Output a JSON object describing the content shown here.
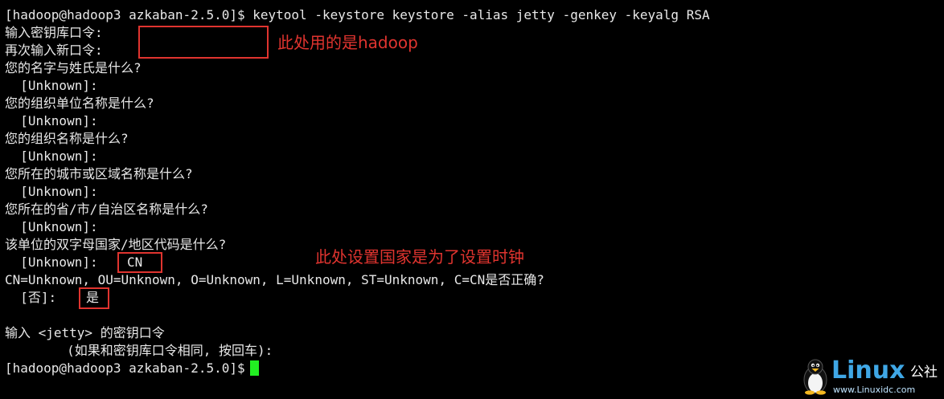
{
  "terminal": {
    "lines": [
      "[hadoop@hadoop3 azkaban-2.5.0]$ keytool -keystore keystore -alias jetty -genkey -keyalg RSA",
      "输入密钥库口令:",
      "再次输入新口令:",
      "您的名字与姓氏是什么?",
      "  [Unknown]:",
      "您的组织单位名称是什么?",
      "  [Unknown]:",
      "您的组织名称是什么?",
      "  [Unknown]:",
      "您所在的城市或区域名称是什么?",
      "  [Unknown]:",
      "您所在的省/市/自治区名称是什么?",
      "  [Unknown]:",
      "该单位的双字母国家/地区代码是什么?",
      "  [Unknown]:",
      "CN=Unknown, OU=Unknown, O=Unknown, L=Unknown, ST=Unknown, C=CN是否正确?",
      "  [否]:",
      "",
      "输入 <jetty> 的密钥口令",
      "        (如果和密钥库口令相同, 按回车):",
      "[hadoop@hadoop3 azkaban-2.5.0]$"
    ],
    "inputs": {
      "country_code": "CN",
      "confirm": "是"
    },
    "cursor_color": "#22ee22"
  },
  "annotations": {
    "password_note": "此处用的是hadoop",
    "country_note": "此处设置国家是为了设置时钟",
    "color": "#e0342f"
  },
  "watermark": {
    "logo_text": "Linux",
    "logo_suffix": "公社",
    "url": "www.Linuxidc.com"
  }
}
